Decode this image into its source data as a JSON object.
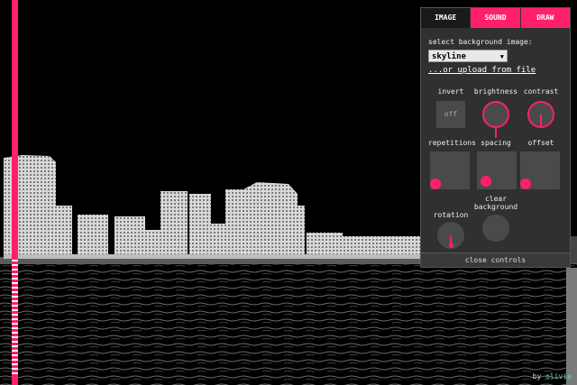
{
  "tabs": [
    {
      "label": "IMAGE",
      "active": true
    },
    {
      "label": "SOUND",
      "active": false
    },
    {
      "label": "DRAW",
      "active": false
    }
  ],
  "image": {
    "select_label": "select background image:",
    "selected_image": "skyline",
    "upload_link": "...or upload from file",
    "controls": {
      "invert": {
        "label": "invert",
        "value": "off"
      },
      "brightness": {
        "label": "brightness"
      },
      "contrast": {
        "label": "contrast"
      },
      "repetitions": {
        "label": "repetitions"
      },
      "spacing": {
        "label": "spacing"
      },
      "offset": {
        "label": "offset"
      },
      "rotation": {
        "label": "rotation"
      },
      "clear_background": {
        "label_line1": "clear",
        "label_line2": "background"
      }
    },
    "close": "close controls"
  },
  "credit": {
    "prefix": "by",
    "author": "olivia"
  },
  "colors": {
    "accent": "#ff1f6b",
    "panel": "#303030",
    "control": "#4a4a4a",
    "credit_link": "#6fd6a6"
  }
}
